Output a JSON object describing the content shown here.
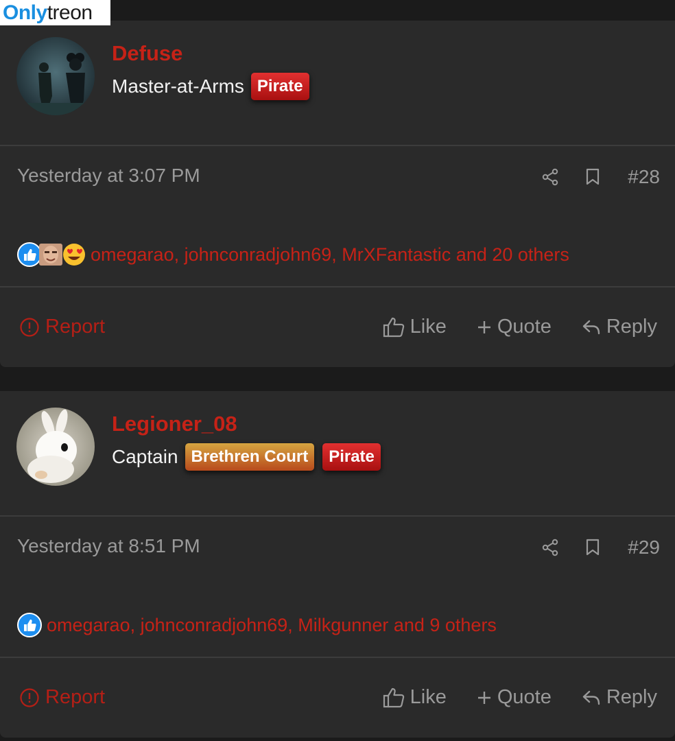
{
  "watermark": {
    "part1": "Only",
    "part2": "treon"
  },
  "posts": [
    {
      "username": "Defuse",
      "rank": "Master-at-Arms",
      "badges": [
        "Pirate"
      ],
      "timestamp": "Yesterday at 3:07 PM",
      "post_number": "#28",
      "reactions_text": "omegarao, johnconradjohn69, MrXFantastic and 20 others",
      "reaction_icons": [
        "like-reaction-icon",
        "face-avatar",
        "heart-eyes-emoji"
      ],
      "actions": {
        "report": "Report",
        "like": "Like",
        "quote": "Quote",
        "reply": "Reply"
      }
    },
    {
      "username": "Legioner_08",
      "rank": "Captain",
      "badges": [
        "Brethren Court",
        "Pirate"
      ],
      "timestamp": "Yesterday at 8:51 PM",
      "post_number": "#29",
      "reactions_text": "omegarao, johnconradjohn69, Milkgunner and 9 others",
      "reaction_icons": [
        "like-reaction-icon"
      ],
      "actions": {
        "report": "Report",
        "like": "Like",
        "quote": "Quote",
        "reply": "Reply"
      }
    }
  ],
  "colors": {
    "background": "#1b1b1b",
    "card": "#2a2a2a",
    "accent_red": "#c62217",
    "muted_text": "#9a9a9a",
    "badge_pirate": "#d42020",
    "badge_court": "#c98030"
  }
}
